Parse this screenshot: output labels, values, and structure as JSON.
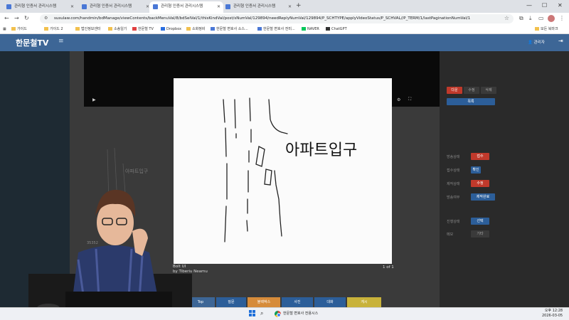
{
  "browser": {
    "tabs": [
      {
        "label": "관리형 인증서 관리시스템"
      },
      {
        "label": "관리형 인증서 관리시스템"
      },
      {
        "label": "관리형 인증서 관리시스템"
      },
      {
        "label": "관리형 인증서 관리시스템"
      }
    ],
    "new_tab_label": "+",
    "url": "susulaw.com/handmin/bdManage/viewContents/backMenuVal/8/bdSelVal/1/thisKindVal/post/sNumVal/129894/needReplyNumVal/129894/P_SCHTYPE/applyVideoStatus/P_SCHVAL//P_TERM/1/lastPaginationNumVal/1",
    "bookmarks": [
      {
        "label": "가이드"
      },
      {
        "label": "가이드 2"
      },
      {
        "label": "법인정보센터"
      },
      {
        "label": "소송일기"
      },
      {
        "label": "한문철 TV"
      },
      {
        "label": "Dropbox"
      },
      {
        "label": "소화정비"
      },
      {
        "label": "한문철 변호사 소스..."
      },
      {
        "label": "한문철 변호사 전미..."
      },
      {
        "label": "NAVER"
      },
      {
        "label": "ChatGPT"
      },
      {
        "label": "모든 북마크"
      }
    ]
  },
  "site": {
    "logo": "한문철TV",
    "user_label": "관리자",
    "right_buttons": {
      "top_a": "다운",
      "top_b": "수정",
      "top_c": "삭제",
      "list": "목록",
      "status1": "접수",
      "status2": "확인",
      "status3": "수정",
      "status4": "제작완료",
      "status5": "선택",
      "status6": "기타"
    },
    "right_labels": {
      "l1": "방송상태",
      "l2": "접수상태",
      "l3": "제작상태",
      "l4": "방송여부",
      "l5": "진행상태",
      "l6": "메모"
    },
    "meta_number": "35352",
    "sketch_text": "아파트입구",
    "footer_nav": [
      "Top",
      "질문",
      "블랙박스",
      "사진",
      "대화",
      "게시"
    ]
  },
  "viewer": {
    "handwritten_text": "아파트입구",
    "caption_line1": "Bolt UI",
    "caption_line2": "by Tiberiu Neamu",
    "counter": "1 of 1"
  },
  "taskbar": {
    "app_label": "한문철 변호사 전용시스",
    "time": "오후 12:28",
    "date": "2026-03-05"
  }
}
